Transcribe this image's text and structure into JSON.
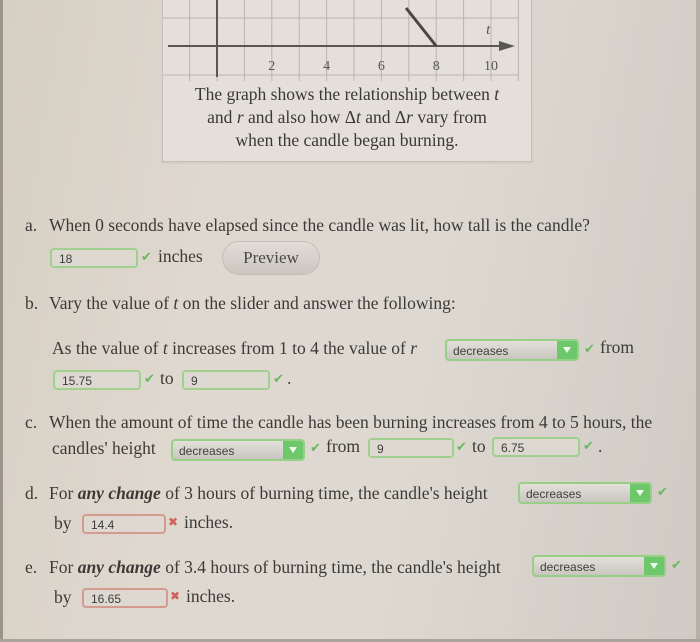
{
  "figure": {
    "x_ticks": [
      "2",
      "4",
      "6",
      "8",
      "10"
    ],
    "axis_label": "t",
    "caption_lines": [
      [
        "The graph shows the relationship between ",
        "t"
      ],
      [
        "and ",
        "r",
        " and also how Δ",
        "t",
        " and Δ",
        "r",
        " vary from"
      ],
      [
        "when the candle began burning."
      ]
    ]
  },
  "chart_data": {
    "type": "line",
    "title": "",
    "xlabel": "t",
    "ylabel": "",
    "x_ticks": [
      2,
      4,
      6,
      8,
      10
    ],
    "xlim": [
      -1,
      11
    ],
    "series": [
      {
        "name": "r",
        "x": [
          6.9,
          8
        ],
        "y": [
          2,
          0
        ]
      }
    ],
    "grid": true,
    "note": "Cropped view; only the bottom of the graph is visible. Line reaches r = 0 at t = 8."
  },
  "questions": {
    "a": {
      "label": "a.",
      "text": "When 0 seconds have elapsed since the candle was lit, how tall is the candle?",
      "answer": "18",
      "answer_status": "correct",
      "unit": "inches",
      "preview_button": "Preview"
    },
    "b": {
      "label": "b.",
      "text_pre": "Vary the value of ",
      "text_var": "t",
      "text_post": " on the slider and answer the following:",
      "sentence_pre": "As the value of ",
      "sentence_var1": "t",
      "sentence_mid": " increases from 1 to 4 the value of ",
      "sentence_var2": "r",
      "dropdown": "decreases",
      "from_word": "from",
      "from_value": "15.75",
      "to_word": "to",
      "to_value": "9",
      "end": "."
    },
    "c": {
      "label": "c.",
      "text_line1": "When the amount of time the candle has been burning increases from 4 to 5 hours, the",
      "text_line2": "candles' height",
      "dropdown": "decreases",
      "from_word": "from",
      "from_value": "9",
      "to_word": "to",
      "to_value": "6.75",
      "end": "."
    },
    "d": {
      "label": "d.",
      "text_pre": "For ",
      "text_em": "any change",
      "text_post": " of 3 hours of burning time, the candle's height",
      "dropdown": "decreases",
      "by_word": "by",
      "answer": "14.4",
      "answer_status": "incorrect",
      "unit": "inches."
    },
    "e": {
      "label": "e.",
      "text_pre": "For ",
      "text_em": "any change",
      "text_post": " of 3.4 hours of burning time, the candle's height",
      "dropdown": "decreases",
      "by_word": "by",
      "answer": "16.65",
      "answer_status": "incorrect",
      "unit": "inches."
    }
  },
  "colors": {
    "correct": "#68b860",
    "incorrect": "#d0605a",
    "dropdown_arrow": "#6cc86a"
  }
}
